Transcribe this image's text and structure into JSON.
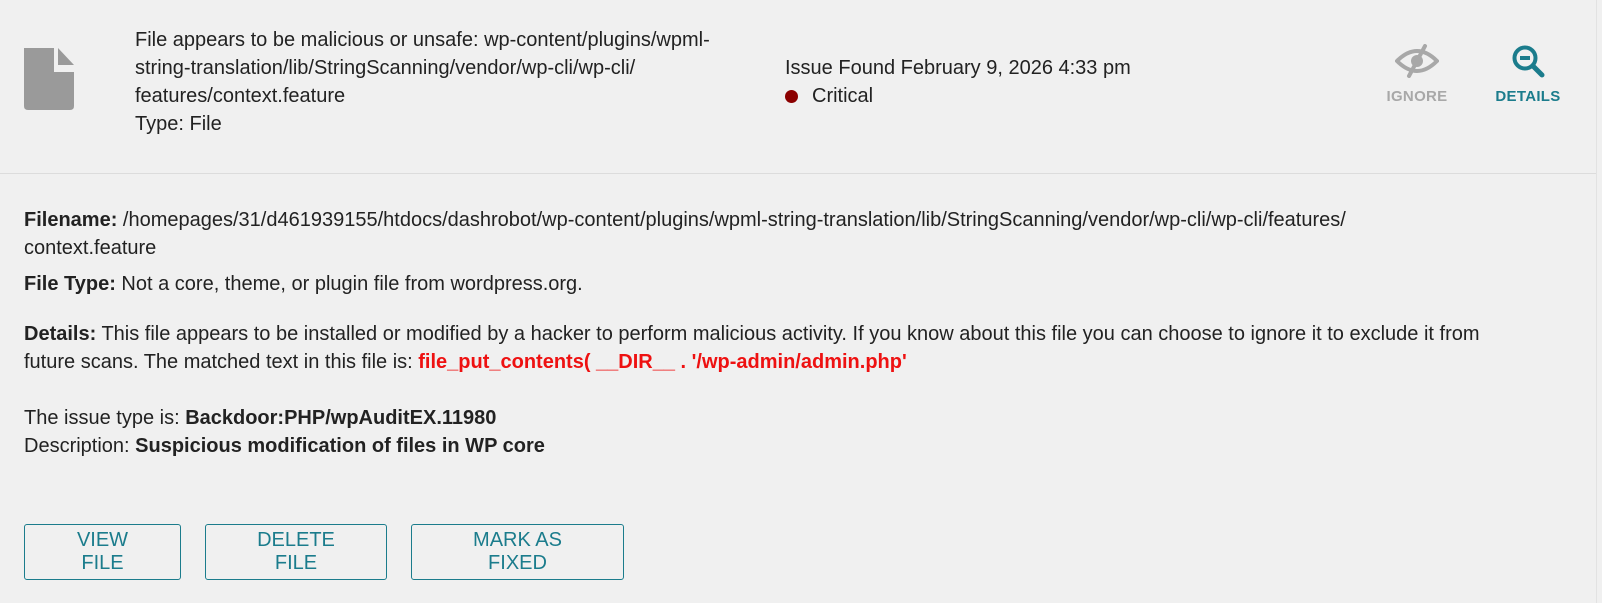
{
  "issue": {
    "summary_lines": [
      "File appears to be malicious or unsafe: wp-content/plugins/wpml-",
      "string-translation/lib/StringScanning/vendor/wp-cli/wp-cli/",
      "features/context.feature"
    ],
    "type_line": "Type: File",
    "found_label": "Issue Found February 9, 2026 4:33 pm",
    "severity": "Critical",
    "severity_color": "#8b0000",
    "file_icon": "document-icon"
  },
  "actions": {
    "ignore_label": "IGNORE",
    "ignore_icon": "eye-slash-icon",
    "details_label": "DETAILS",
    "details_icon": "zoom-out-icon"
  },
  "details": {
    "filename_label": "Filename:",
    "filename_line1": " /homepages/31/d461939155/htdocs/dashrobot/wp-content/plugins/wpml-string-translation/lib/StringScanning/vendor/wp-cli/wp-cli/features/",
    "filename_line2": "context.feature",
    "filetype_label": "File Type:",
    "filetype_value": " Not a core, theme, or plugin file from wordpress.org.",
    "details_label": "Details:",
    "details_line1": " This file appears to be installed or modified by a hacker to perform malicious activity. If you know about this file you can choose to ignore it to exclude it from",
    "details_line2": "future scans. The matched text in this file is: ",
    "matched_text": "file_put_contents( __DIR__ . '/wp-admin/admin.php'",
    "issue_type_label": "The issue type is: ",
    "issue_type_value": "Backdoor:PHP/wpAuditEX.11980",
    "description_label": "Description: ",
    "description_value": "Suspicious modification of files in WP core"
  },
  "buttons": {
    "view_file": "VIEW FILE",
    "delete_file": "DELETE FILE",
    "mark_fixed": "MARK AS FIXED"
  },
  "colors": {
    "accent": "#1b7c8c",
    "match": "#ee1111",
    "muted": "#a8a8a8"
  }
}
